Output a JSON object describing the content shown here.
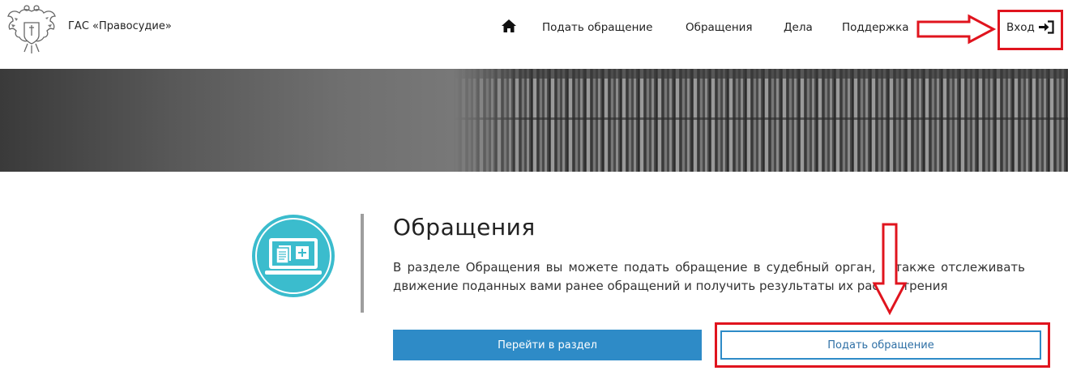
{
  "header": {
    "site_title": "ГАС «Правосудие»",
    "nav": [
      {
        "label": "Подать обращение"
      },
      {
        "label": "Обращения"
      },
      {
        "label": "Дела"
      },
      {
        "label": "Поддержка"
      }
    ],
    "login_label": "Вход"
  },
  "section": {
    "title": "Обращения",
    "description": "В разделе Обращения вы можете подать обращение в судебный орган, а также отслеживать движение поданных вами ранее обращений и получить результаты их рассмотрения",
    "primary_button": "Перейти в раздел",
    "secondary_button": "Подать обращение"
  },
  "colors": {
    "accent_blue": "#2e8bc7",
    "icon_teal": "#3bbccd",
    "annotation_red": "#e0141e"
  },
  "icons": {
    "logo": "coat-of-arms-emblem",
    "home": "home-icon",
    "login": "sign-in-icon",
    "section": "appeal-laptop-icon"
  }
}
